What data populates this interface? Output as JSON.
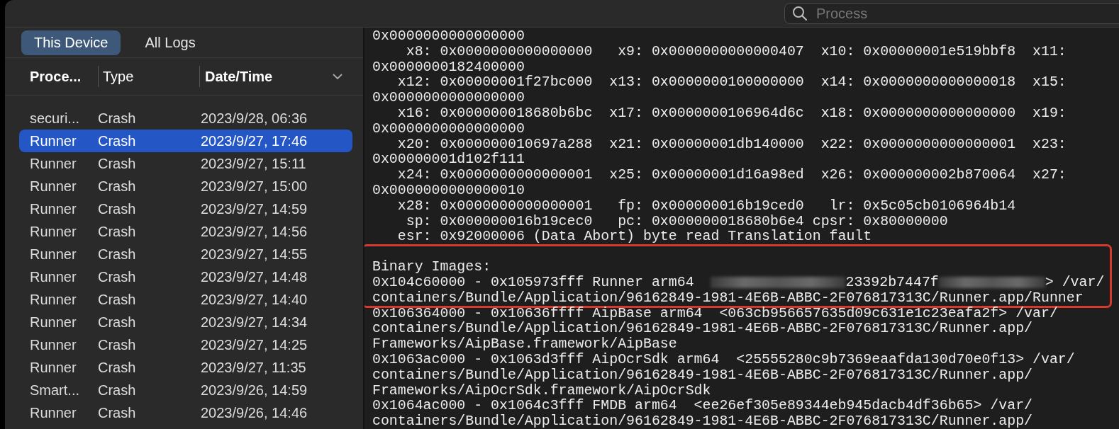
{
  "search": {
    "placeholder": "Process"
  },
  "tabs": [
    {
      "label": "This Device",
      "selected": true
    },
    {
      "label": "All Logs",
      "selected": false
    }
  ],
  "table": {
    "columns": [
      {
        "label": "Proce...",
        "bold": true
      },
      {
        "label": "Type",
        "bold": false
      },
      {
        "label": "Date/Time",
        "bold": true,
        "sorted": true
      }
    ],
    "rows": [
      {
        "process": "securi...",
        "type": "Crash",
        "datetime": "2023/9/28, 06:36",
        "selected": false
      },
      {
        "process": "Runner",
        "type": "Crash",
        "datetime": "2023/9/27, 17:46",
        "selected": true
      },
      {
        "process": "Runner",
        "type": "Crash",
        "datetime": "2023/9/27, 15:11",
        "selected": false
      },
      {
        "process": "Runner",
        "type": "Crash",
        "datetime": "2023/9/27, 15:00",
        "selected": false
      },
      {
        "process": "Runner",
        "type": "Crash",
        "datetime": "2023/9/27, 14:59",
        "selected": false
      },
      {
        "process": "Runner",
        "type": "Crash",
        "datetime": "2023/9/27, 14:56",
        "selected": false
      },
      {
        "process": "Runner",
        "type": "Crash",
        "datetime": "2023/9/27, 14:55",
        "selected": false
      },
      {
        "process": "Runner",
        "type": "Crash",
        "datetime": "2023/9/27, 14:48",
        "selected": false
      },
      {
        "process": "Runner",
        "type": "Crash",
        "datetime": "2023/9/27, 14:40",
        "selected": false
      },
      {
        "process": "Runner",
        "type": "Crash",
        "datetime": "2023/9/27, 14:34",
        "selected": false
      },
      {
        "process": "Runner",
        "type": "Crash",
        "datetime": "2023/9/27, 14:25",
        "selected": false
      },
      {
        "process": "Runner",
        "type": "Crash",
        "datetime": "2023/9/27, 11:35",
        "selected": false
      },
      {
        "process": "Smart...",
        "type": "Crash",
        "datetime": "2023/9/26, 14:59",
        "selected": false
      },
      {
        "process": "Runner",
        "type": "Crash",
        "datetime": "2023/9/26, 14:46",
        "selected": false
      }
    ]
  },
  "log": {
    "blocks": [
      {
        "highlighted": false,
        "lines": [
          {
            "kind": "text",
            "text": "0x0000000000000000"
          },
          {
            "kind": "text",
            "text": "    x8: 0x0000000000000000   x9: 0x0000000000000407  x10: 0x00000001e519bbf8  x11:"
          },
          {
            "kind": "text",
            "text": "0x0000000182400000"
          },
          {
            "kind": "text",
            "text": "   x12: 0x00000001f27bc000  x13: 0x0000000100000000  x14: 0x0000000000000018  x15:"
          },
          {
            "kind": "text",
            "text": "0x0000000000000000"
          },
          {
            "kind": "text",
            "text": "   x16: 0x000000018680b6bc  x17: 0x0000000106964d6c  x18: 0x0000000000000000  x19:"
          },
          {
            "kind": "text",
            "text": "0x0000000000000000"
          },
          {
            "kind": "text",
            "text": "   x20: 0x000000010697a288  x21: 0x00000001db140000  x22: 0x0000000000000001  x23:"
          },
          {
            "kind": "text",
            "text": "0x00000001d102f111"
          },
          {
            "kind": "text",
            "text": "   x24: 0x0000000000000001  x25: 0x00000001d16a98ed  x26: 0x000000002b870064  x27:"
          },
          {
            "kind": "text",
            "text": "0x0000000000000010"
          },
          {
            "kind": "text",
            "text": "   x28: 0x0000000000000001   fp: 0x000000016b19ced0   lr: 0x5c05cb0106964b14"
          },
          {
            "kind": "text",
            "text": "    sp: 0x000000016b19cec0   pc: 0x000000018680b6e4 cpsr: 0x80000000"
          },
          {
            "kind": "text",
            "text": "   esr: 0x92000006 (Data Abort) byte read Translation fault"
          }
        ]
      },
      {
        "highlighted": true,
        "lines": [
          {
            "kind": "text",
            "text": "Binary Images:"
          },
          {
            "kind": "redacted",
            "segments": [
              {
                "kind": "text",
                "text": "0x104c60000 - 0x105973fff Runner arm64  "
              },
              {
                "kind": "blur"
              },
              {
                "kind": "text",
                "text": "23392b7447f"
              },
              {
                "kind": "blur"
              },
              {
                "kind": "text",
                "text": "> /var/"
              }
            ]
          },
          {
            "kind": "text",
            "text": "containers/Bundle/Application/96162849-1981-4E6B-ABBC-2F076817313C/Runner.app/Runner"
          }
        ]
      },
      {
        "highlighted": false,
        "lines": [
          {
            "kind": "text",
            "text": "0x106364000 - 0x10636ffff AipBase arm64  <063cb956657635d09c631e1c23eafa2f> /var/"
          },
          {
            "kind": "text",
            "text": "containers/Bundle/Application/96162849-1981-4E6B-ABBC-2F076817313C/Runner.app/"
          },
          {
            "kind": "text",
            "text": "Frameworks/AipBase.framework/AipBase"
          },
          {
            "kind": "text",
            "text": "0x1063ac000 - 0x1063d3fff AipOcrSdk arm64  <25555280c9b7369eaafda130d70e0f13> /var/"
          },
          {
            "kind": "text",
            "text": "containers/Bundle/Application/96162849-1981-4E6B-ABBC-2F076817313C/Runner.app/"
          },
          {
            "kind": "text",
            "text": "Frameworks/AipOcrSdk.framework/AipOcrSdk"
          },
          {
            "kind": "text",
            "text": "0x1064ac000 - 0x1064c3fff FMDB arm64  <ee26ef305e89344eb945dacb4df36b65> /var/"
          },
          {
            "kind": "text",
            "text": "containers/Bundle/Application/96162849-1981-4E6B-ABBC-2F076817313C/Runner.app/"
          }
        ]
      }
    ]
  }
}
